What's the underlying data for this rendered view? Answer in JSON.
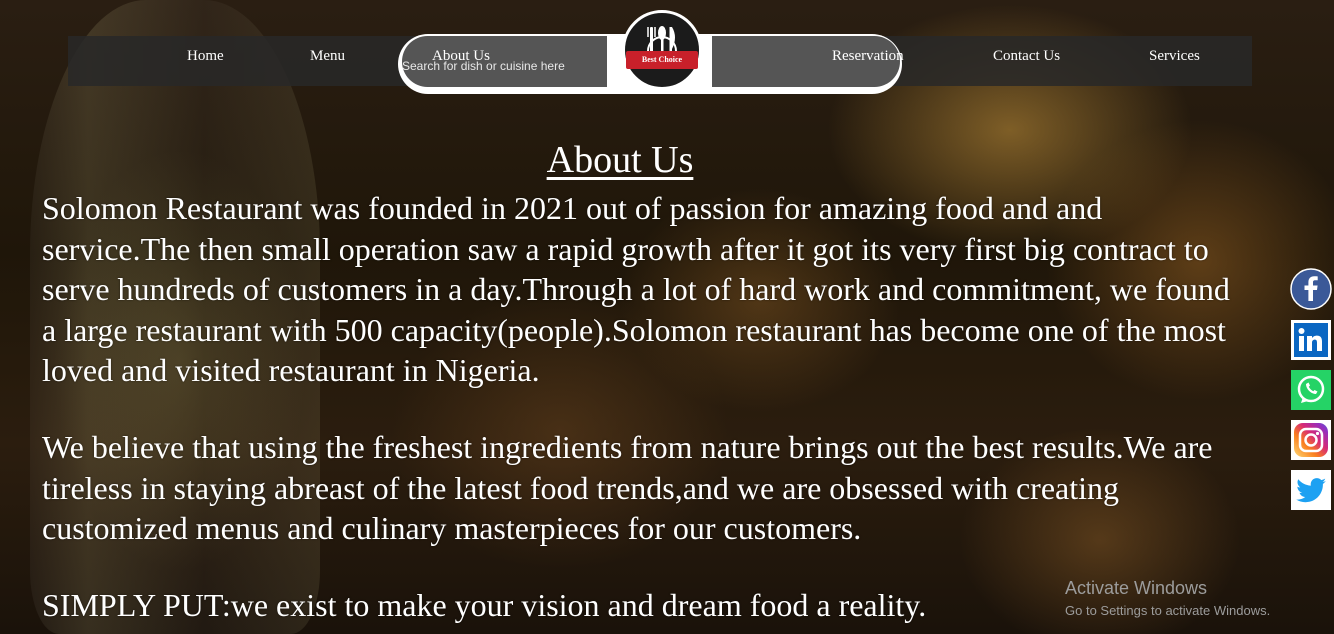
{
  "nav": {
    "home": "Home",
    "menu": "Menu",
    "about": "About Us",
    "reservation": "Reservation",
    "contact": "Contact Us",
    "services": "Services"
  },
  "search": {
    "placeholder": "Search for dish or cuisine here"
  },
  "logo": {
    "ribbon_text": "Best Choice"
  },
  "about": {
    "title": "About Us",
    "paragraph1": "Solomon Restaurant was founded in 2021 out of passion for amazing food and and service.The then small operation saw a rapid growth after it got its very first big contract to serve hundreds of customers in a day.Through a lot of hard work and commitment, we found a large restaurant with 500 capacity(people).Solomon restaurant has become one of the most loved and visited restaurant in Nigeria.",
    "paragraph2": "We believe that using the freshest ingredients from nature brings out the best results.We are tireless in staying abreast of the latest food trends,and we are obsessed with creating customized menus and culinary masterpieces for our customers.",
    "paragraph3": "SIMPLY PUT:we exist to make your vision and dream food a reality."
  },
  "social": [
    {
      "name": "facebook-icon",
      "color": "#3b5998"
    },
    {
      "name": "linkedin-icon",
      "color": "#0a66c2"
    },
    {
      "name": "whatsapp-icon",
      "color": "#25d366"
    },
    {
      "name": "instagram-icon",
      "color": "#c13584"
    },
    {
      "name": "twitter-icon",
      "color": "#1da1f2"
    }
  ],
  "watermark": {
    "line1": "Activate Windows",
    "line2": "Go to Settings to activate Windows."
  }
}
